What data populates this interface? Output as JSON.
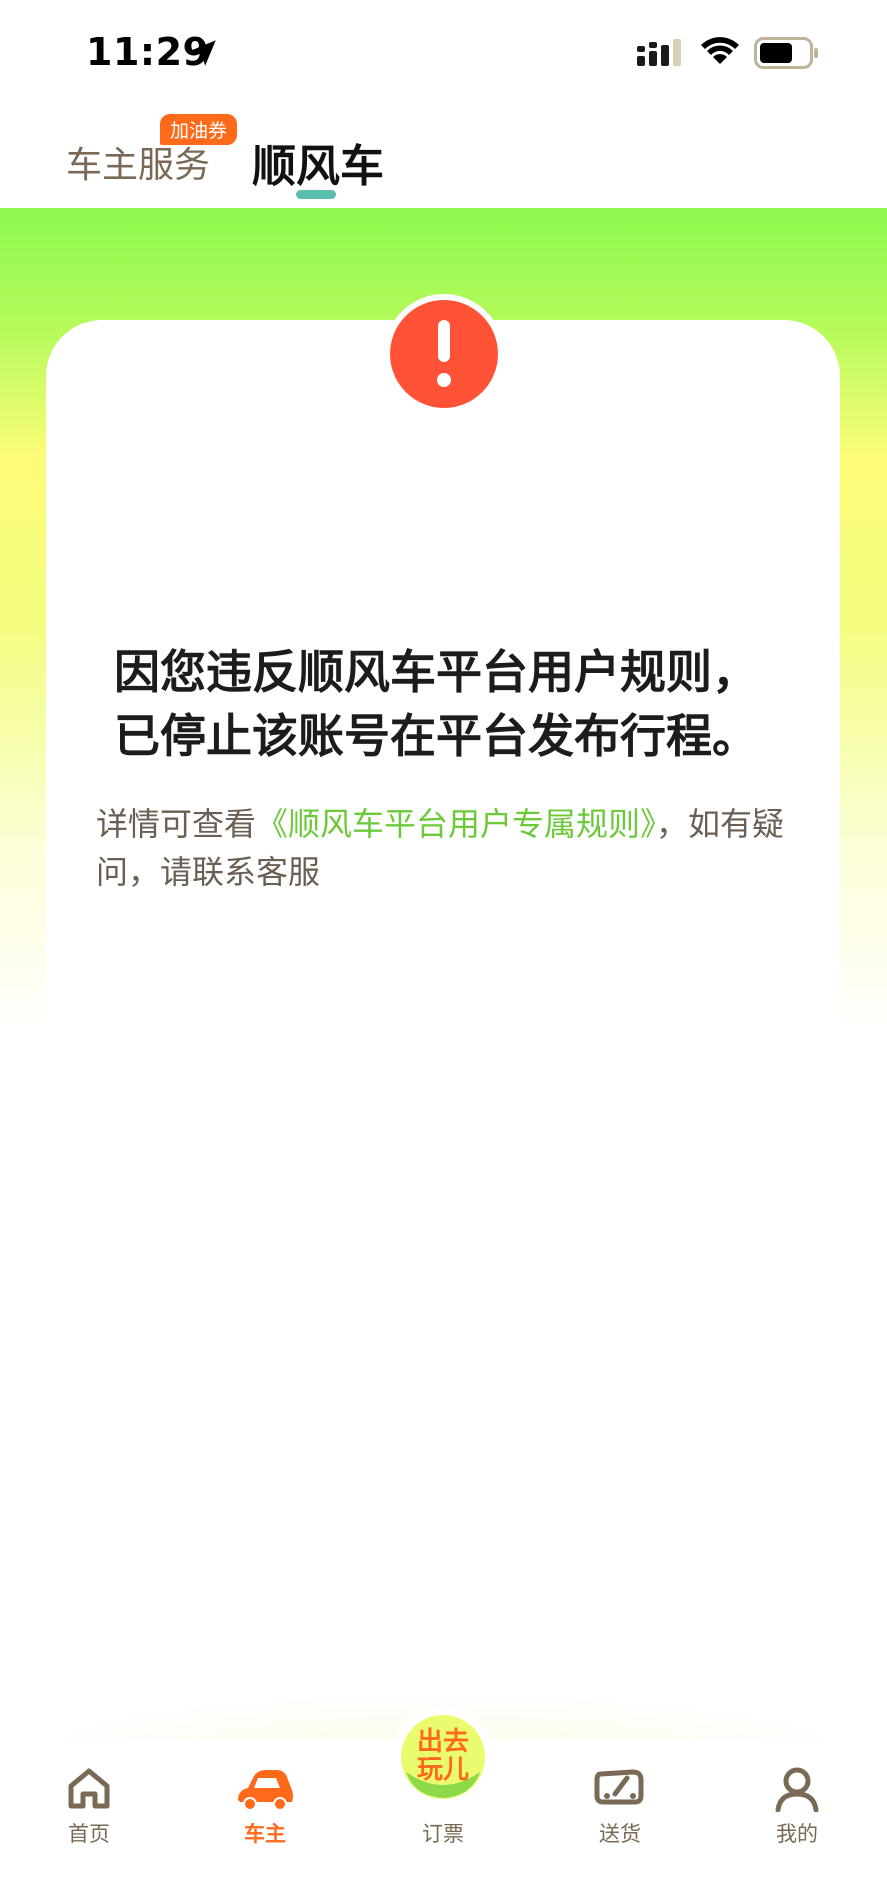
{
  "status_bar": {
    "time": "11:29"
  },
  "top_tabs": {
    "owner_service": "车主服务",
    "coupon_badge": "加油券",
    "ride": "顺风车"
  },
  "notice": {
    "headline_line1": "因您违反顺风车平台用户规则，",
    "headline_line2": "已停止该账号在平台发布行程。",
    "detail_prefix": "详情可查看",
    "detail_link": "《顺风车平台用户专属规则》",
    "detail_suffix": "，如有疑问，请联系客服"
  },
  "bottom_nav": {
    "home": "首页",
    "owner": "车主",
    "ticket": "订票",
    "delivery": "送货",
    "mine": "我的",
    "promo_text_line1": "出去",
    "promo_text_line2": "玩儿"
  },
  "colors": {
    "accent_orange": "#ff6a1a",
    "link_green": "#6cc93a",
    "alert_red": "#ff5236",
    "tab_indicator": "#5bbfae"
  }
}
